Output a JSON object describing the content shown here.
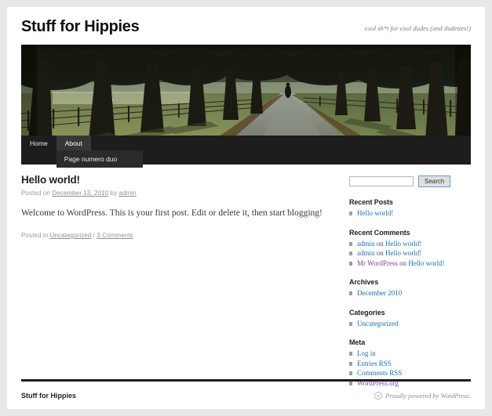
{
  "site": {
    "title": "Stuff for Hippies",
    "description": "cool sh*t for cool dudes (and dudettes!)"
  },
  "header_image": {
    "icon": "tree-lined-path-photo",
    "alt": "Tree-lined path with wooden fence and walking figure"
  },
  "nav": {
    "items": [
      {
        "label": "Home",
        "state": "default"
      },
      {
        "label": "About",
        "state": "active"
      }
    ],
    "submenu": [
      {
        "label": "Page numero duo"
      }
    ]
  },
  "post": {
    "title": "Hello world!",
    "meta_prefix": "Posted on ",
    "meta_date": "December 13, 2010",
    "meta_by": " by ",
    "meta_author": "admin",
    "body": "Welcome to WordPress. This is your first post. Edit or delete it, then start blogging!",
    "footer_prefix": "Posted in ",
    "footer_category": "Uncategorized",
    "footer_sep": " | ",
    "footer_comments": "3 Comments"
  },
  "sidebar": {
    "search": {
      "value": "",
      "placeholder": "",
      "button_label": "Search",
      "icon": "search-icon"
    },
    "widgets": [
      {
        "title": "Recent Posts",
        "items": [
          {
            "text": "Hello world!",
            "link": true,
            "visited": false
          }
        ]
      },
      {
        "title": "Recent Comments",
        "items": [
          {
            "author": "admin",
            "author_visited": false,
            "on": " on ",
            "post": "Hello world!",
            "post_visited": false
          },
          {
            "author": "admin",
            "author_visited": false,
            "on": " on ",
            "post": "Hello world!",
            "post_visited": false
          },
          {
            "author": "Mr WordPress",
            "author_visited": true,
            "on": " on ",
            "post": "Hello world!",
            "post_visited": false
          }
        ]
      },
      {
        "title": "Archives",
        "items": [
          {
            "text": "December 2010",
            "link": true,
            "visited": false
          }
        ]
      },
      {
        "title": "Categories",
        "items": [
          {
            "text": "Uncategorized",
            "link": true,
            "visited": false
          }
        ]
      },
      {
        "title": "Meta",
        "items": [
          {
            "text": "Log in",
            "link": true,
            "visited": false
          },
          {
            "text": "Entries RSS",
            "link": true,
            "visited": false
          },
          {
            "text": "Comments RSS",
            "link": true,
            "visited": false
          },
          {
            "text": "WordPress.org",
            "link": true,
            "visited": true
          }
        ]
      }
    ]
  },
  "footer": {
    "title": "Stuff for Hippies",
    "credit": "Proudly powered by WordPress.",
    "logo_icon": "wordpress-logo-icon"
  },
  "colors": {
    "link": "#1b6fb2",
    "visited_link": "#7b3fa0",
    "nav_background": "#1d1d1d",
    "nav_active": "#373737",
    "submenu_background": "#2b2b2b",
    "page_background": "#ffffff",
    "outer_background": "#e8e8e8",
    "text": "#373737",
    "meta_text": "#9a9a9a"
  }
}
